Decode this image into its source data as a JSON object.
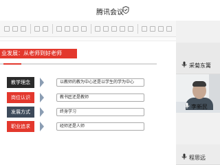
{
  "window": {
    "title": "腾讯会议",
    "title_icon": "shield-icon"
  },
  "slide": {
    "heading": "业发展：从老师到好老师",
    "accent_color": "#e3382d",
    "rows": [
      {
        "tag": "教学理念",
        "text": "以教师的教为中心还是以学生的学为中心",
        "color": "#2b2b2b"
      },
      {
        "tag": "岗位认识",
        "text": "教书匠还是教师",
        "color": "#e3382d"
      },
      {
        "tag": "发展方式",
        "text": "终身学习",
        "color": "#3d4a5a"
      },
      {
        "tag": "职业追求",
        "text": "经师还是人师",
        "color": "#e3382d"
      }
    ]
  },
  "participants": [
    {
      "name": "采菊东篱",
      "mic_icon": "microphone-icon"
    },
    {
      "name": "李新民",
      "mic_icon": "microphone-icon",
      "video": true
    },
    {
      "name": "程思远",
      "mic_icon": "microphone-icon"
    }
  ]
}
